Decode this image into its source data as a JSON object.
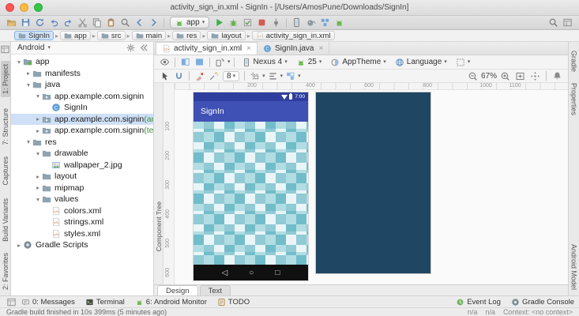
{
  "window": {
    "title": "activity_sign_in.xml - SignIn - [/Users/AmosPune/Downloads/SignIn]"
  },
  "main_toolbar": {
    "run_config": "app",
    "icons_left": [
      "open",
      "save-all",
      "sync",
      "undo",
      "redo",
      "cut",
      "copy",
      "paste",
      "find",
      "back",
      "forward"
    ],
    "icons_run": [
      "run",
      "debug",
      "coverage",
      "stop",
      "attach"
    ],
    "icons_tools": [
      "avd-manager",
      "gradle-sync",
      "project-structure",
      "sdk-manager"
    ],
    "icons_right": [
      "search",
      "window"
    ]
  },
  "breadcrumbs": [
    {
      "label": "SignIn",
      "icon": "folder",
      "selected": true
    },
    {
      "label": "app",
      "icon": "folder"
    },
    {
      "label": "src",
      "icon": "folder"
    },
    {
      "label": "main",
      "icon": "folder"
    },
    {
      "label": "res",
      "icon": "folder"
    },
    {
      "label": "layout",
      "icon": "folder"
    },
    {
      "label": "activity_sign_in.xml",
      "icon": "xml"
    }
  ],
  "tool_strips": {
    "left_top": [
      "1: Project",
      "7: Structure",
      "Captures"
    ],
    "left_active": "1: Project",
    "left_bottom": [
      "Build Variants",
      "2: Favorites"
    ],
    "right_top": [
      "Gradle",
      "Properties"
    ],
    "right_bottom": [
      "Android Model"
    ]
  },
  "project_panel": {
    "view_selector": "Android",
    "tree": [
      {
        "indent": 0,
        "arrow": "open",
        "icon": "module",
        "label": "app"
      },
      {
        "indent": 1,
        "arrow": "closed",
        "icon": "folder",
        "label": "manifests"
      },
      {
        "indent": 1,
        "arrow": "open",
        "icon": "folder",
        "label": "java"
      },
      {
        "indent": 2,
        "arrow": "open",
        "icon": "package",
        "label": "app.example.com.signin"
      },
      {
        "indent": 3,
        "arrow": "none",
        "icon": "class",
        "label": "SignIn"
      },
      {
        "indent": 2,
        "arrow": "closed",
        "icon": "package",
        "label": "app.example.com.signin",
        "suffix": " (androidTe",
        "selected": true
      },
      {
        "indent": 2,
        "arrow": "closed",
        "icon": "package",
        "label": "app.example.com.signin",
        "suffix": " (test)"
      },
      {
        "indent": 1,
        "arrow": "open",
        "icon": "folder",
        "label": "res"
      },
      {
        "indent": 2,
        "arrow": "open",
        "icon": "folder",
        "label": "drawable"
      },
      {
        "indent": 3,
        "arrow": "none",
        "icon": "image",
        "label": "wallpaper_2.jpg"
      },
      {
        "indent": 2,
        "arrow": "closed",
        "icon": "folder",
        "label": "layout"
      },
      {
        "indent": 2,
        "arrow": "closed",
        "icon": "folder",
        "label": "mipmap"
      },
      {
        "indent": 2,
        "arrow": "open",
        "icon": "folder",
        "label": "values"
      },
      {
        "indent": 3,
        "arrow": "none",
        "icon": "xml",
        "label": "colors.xml"
      },
      {
        "indent": 3,
        "arrow": "none",
        "icon": "xml",
        "label": "strings.xml"
      },
      {
        "indent": 3,
        "arrow": "none",
        "icon": "xml",
        "label": "styles.xml"
      },
      {
        "indent": 0,
        "arrow": "closed",
        "icon": "gradle",
        "label": "Gradle Scripts"
      }
    ]
  },
  "editor": {
    "tabs": [
      {
        "label": "activity_sign_in.xml",
        "active": true
      },
      {
        "label": "SignIn.java",
        "active": false
      }
    ],
    "design_toolbar": {
      "device": "Nexus 4",
      "api": "25",
      "theme": "AppTheme",
      "language": "Language",
      "default_margin": "8",
      "zoom": "67%"
    },
    "rulers": {
      "horizontal": [
        "200",
        "400",
        "600",
        "800",
        "1000",
        "1100"
      ],
      "vertical": [
        "100",
        "200",
        "300",
        "400",
        "500",
        "600"
      ]
    },
    "preview": {
      "status_time": "7:00",
      "app_title": "SignIn"
    },
    "component_tree_label": "Component Tree",
    "mode_tabs": [
      {
        "label": "Design",
        "active": true
      },
      {
        "label": "Text",
        "active": false
      }
    ]
  },
  "bottom_bar": {
    "left": [
      {
        "label": "0: Messages",
        "icon": "messages"
      },
      {
        "label": "Terminal",
        "icon": "terminal"
      },
      {
        "label": "6: Android Monitor",
        "icon": "android"
      },
      {
        "label": "TODO",
        "icon": "todo"
      }
    ],
    "right": [
      {
        "label": "Event Log",
        "icon": "event"
      },
      {
        "label": "Gradle Console",
        "icon": "gradle"
      }
    ]
  },
  "status_bar": {
    "message": "Gradle build finished in 10s 399ms (5 minutes ago)",
    "right": [
      "n/a",
      "n/a",
      "Context: <no context>"
    ]
  },
  "colors": {
    "app_bar": "#3F51B5",
    "status_bar": "#2f3e9e",
    "blueprint": "#1f4662",
    "nav_bar": "#101010",
    "accent_green": "#62b543"
  }
}
